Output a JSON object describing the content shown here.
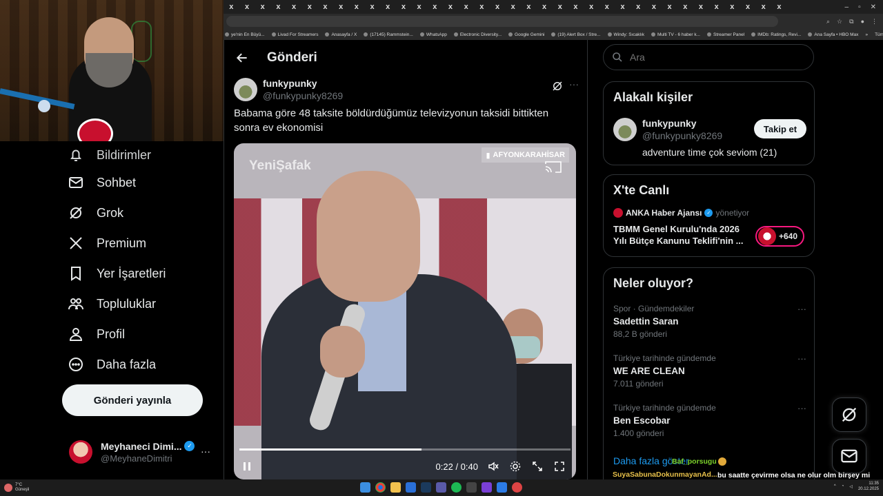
{
  "browser": {
    "tab_close_glyph": "x",
    "tab_count": 36,
    "bookmarks": [
      "ye'nin En Büyü...",
      "Livad For Streamers",
      "Anasayfa / X",
      "(17145) Rammstein...",
      "WhatsApp",
      "Electronic Diversity...",
      "Google Gemini",
      "(19) Alert Box / Stre...",
      "Windy: Sıcaklık",
      "Multi TV - 6 haber k...",
      "Streamer Panel",
      "IMDb: Ratings, Revi...",
      "Ana Sayfa • HBO Max"
    ],
    "bookmarks_more": "»",
    "all_bookmarks": "Tüm Yer İşaretleri"
  },
  "nav": {
    "notifications": "Bildirimler",
    "chat": "Sohbet",
    "grok": "Grok",
    "premium": "Premium",
    "bookmarks": "Yer İşaretleri",
    "communities": "Topluluklar",
    "profile": "Profil",
    "more": "Daha fazla",
    "post_button": "Gönderi yayınla"
  },
  "account": {
    "display_name": "Meyhaneci Dimi...",
    "handle": "@MeyhaneDimitri",
    "more": "···"
  },
  "main": {
    "title": "Gönderi",
    "post": {
      "author_name": "funkypunky",
      "author_handle": "@funkypunky8269",
      "more": "···",
      "text": "Babama göre 48 taksite böldürdüğümüz televizyonun taksidi bittikten sonra ev ekonomisi"
    },
    "video": {
      "watermark": "YeniŞafak",
      "location": "AFYONKARAHİSAR",
      "time": "0:22 / 0:40",
      "progress": 0.55
    }
  },
  "right": {
    "search_placeholder": "Ara",
    "people": {
      "title": "Alakalı kişiler",
      "name": "funkypunky",
      "handle": "@funkypunky8269",
      "bio": "adventure time çok seviom (21)",
      "follow": "Takip et"
    },
    "live": {
      "title": "X'te Canlı",
      "host": "ANKA Haber Ajansı",
      "role": "yönetiyor",
      "live_title": "TBMM Genel Kurulu'nda 2026 Yılı Bütçe Kanunu Teklifi'nin ...",
      "listeners": "+640"
    },
    "trends": {
      "title": "Neler oluyor?",
      "items": [
        {
          "context": "Spor · Gündemdekiler",
          "name": "Sadettin Saran",
          "count": "88,2 B gönderi"
        },
        {
          "context": "Türkiye tarihinde gündemde",
          "name": "WE ARE CLEAN",
          "count": "7.011 gönderi"
        },
        {
          "context": "Türkiye tarihinde gündemde",
          "name": "Ben Escobar",
          "count": "1.400 gönderi"
        }
      ],
      "more_glyph": "···",
      "show_more": "Daha fazla göster"
    }
  },
  "chat": {
    "user1": "Baf_porsugu",
    "user2": "SuyaSabunaDokunmayanAd...",
    "message": "bu saatte çevirme olsa ne olur olm birşey mi kaçırıyoruz"
  },
  "taskbar": {
    "temp": "7°C",
    "weather": "Güneşli",
    "time": "11:35",
    "date": "20.12.2025"
  },
  "colors": {
    "accent": "#1d9bf0",
    "background": "#000000",
    "live_ring": "#f91880"
  }
}
